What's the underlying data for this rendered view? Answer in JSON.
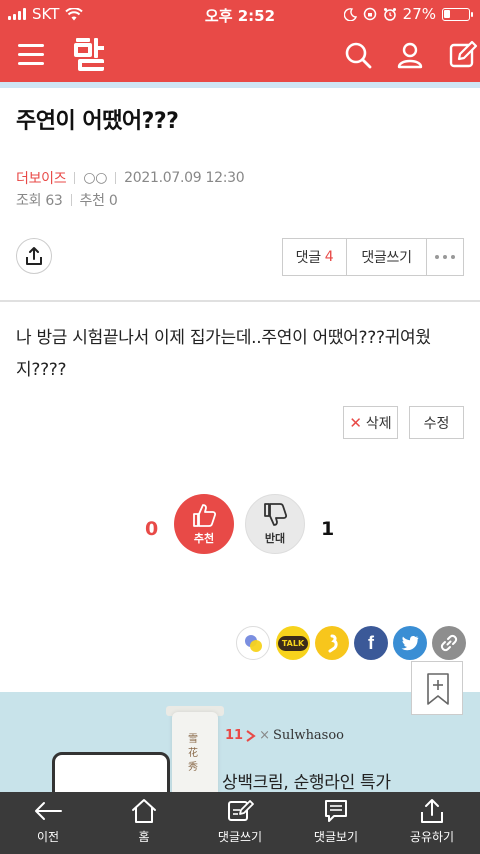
{
  "status_bar": {
    "carrier": "SKT",
    "time": "오후 2:52",
    "battery": "27%",
    "battery_level": 0.27
  },
  "post": {
    "title": "주연이 어땠어???",
    "author": "더보이즈",
    "author_badge": "○○",
    "date": "2021.07.09 12:30",
    "views_label": "조회",
    "views": "63",
    "recommend_label": "추천",
    "recommend": "0",
    "body": "나 방금 시험끝나서 이제 집가는데..주연이 어땠어???귀여웠지????"
  },
  "actions": {
    "comment_label": "댓글",
    "comment_count": "4",
    "write_comment": "댓글쓰기",
    "delete": "삭제",
    "edit": "수정"
  },
  "vote": {
    "up_count": "0",
    "up_label": "추천",
    "down_label": "반대",
    "down_count": "1"
  },
  "social": {
    "talk_label": "TALK",
    "facebook": "f"
  },
  "ad": {
    "brand_11": "11",
    "brand_sep": "×",
    "brand_name": "Sulwhasoo",
    "copy": "상백크림, 순행라인 특가"
  },
  "bottom_nav": [
    {
      "label": "이전",
      "icon": "back-arrow-icon"
    },
    {
      "label": "홈",
      "icon": "home-icon"
    },
    {
      "label": "댓글쓰기",
      "icon": "write-comment-icon"
    },
    {
      "label": "댓글보기",
      "icon": "view-comment-icon"
    },
    {
      "label": "공유하기",
      "icon": "share-icon"
    }
  ],
  "colors": {
    "brand_red": "#e84a47",
    "facebook": "#3b5998",
    "twitter": "#3a8ed4",
    "kakao": "#f7d31c"
  }
}
